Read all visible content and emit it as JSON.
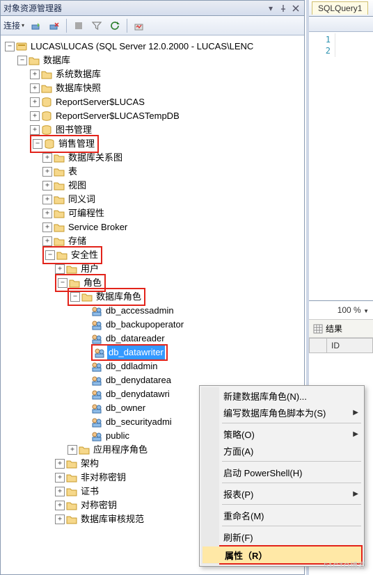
{
  "panel_title": "对象资源管理器",
  "toolbar": {
    "connect_label": "连接"
  },
  "tree": {
    "server": "LUCAS\\LUCAS (SQL Server 12.0.2000 - LUCAS\\LENC",
    "databases": "数据库",
    "sysdb": "系统数据库",
    "snapshots": "数据库快照",
    "rs1": "ReportServer$LUCAS",
    "rs2": "ReportServer$LUCASTempDB",
    "books": "图书管理",
    "sales": "销售管理",
    "diagrams": "数据库关系图",
    "tables": "表",
    "views": "视图",
    "synonyms": "同义词",
    "programmability": "可编程性",
    "sb": "Service Broker",
    "storage": "存储",
    "security": "安全性",
    "users": "用户",
    "roles": "角色",
    "dbroles": "数据库角色",
    "r_accessadmin": "db_accessadmin",
    "r_backup": "db_backupoperator",
    "r_datareader": "db_datareader",
    "r_datawriter": "db_datawriter",
    "r_ddladmin": "db_ddladmin",
    "r_denyreader": "db_denydatarea",
    "r_denywriter": "db_denydatawri",
    "r_owner": "db_owner",
    "r_secadmin": "db_securityadmi",
    "r_public": "public",
    "approles": "应用程序角色",
    "schemas": "架构",
    "asymkeys": "非对称密钥",
    "certs": "证书",
    "symkeys": "对称密钥",
    "truncated": "数据库审核规范"
  },
  "doc_tab": "SQLQuery1",
  "line_numbers": [
    "1",
    "2"
  ],
  "zoom_label": "100 %",
  "results_tab": "结果",
  "grid_col": "ID",
  "ctx": {
    "new_role": "新建数据库角色(N)...",
    "script": "编写数据库角色脚本为(S)",
    "policies": "策略(O)",
    "facets": "方面(A)",
    "powershell": "启动 PowerShell(H)",
    "reports": "报表(P)",
    "rename": "重命名(M)",
    "refresh": "刷新(F)",
    "properties": "属性（R）"
  },
  "watermark": "51CTO博客"
}
